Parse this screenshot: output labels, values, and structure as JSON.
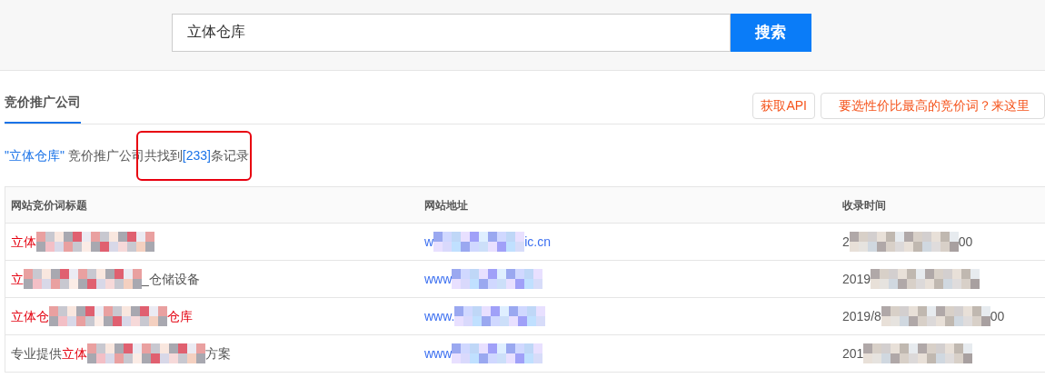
{
  "search": {
    "value": "立体仓库",
    "button": "搜索"
  },
  "tabs": [
    {
      "label": "竞价推广公司",
      "selected": true
    }
  ],
  "actions": [
    "获取API",
    "要选性价比最高的竞价词？来这里"
  ],
  "summary": {
    "query": "\"立体仓库\"",
    "text": " 竞价推广公司共找到",
    "count": "[233]",
    "suffix": "条记录",
    "annotated": true
  },
  "table": {
    "columns": [
      "网站竞价词标题",
      "网站地址",
      "收录时间"
    ],
    "rows": [
      {
        "cells": [
          [
            {
              "kind": "text",
              "text": "立体",
              "highlight": true
            },
            {
              "kind": "mosaic"
            }
          ],
          [
            {
              "kind": "text",
              "text": "w"
            },
            {
              "kind": "mosaic"
            },
            {
              "kind": "text",
              "text": "ic.cn"
            }
          ],
          [
            {
              "kind": "text",
              "text": "2"
            },
            {
              "kind": "mosaic"
            },
            {
              "kind": "text",
              "text": "00"
            }
          ]
        ]
      },
      {
        "cells": [
          [
            {
              "kind": "text",
              "text": "立",
              "highlight": true
            },
            {
              "kind": "mosaic"
            },
            {
              "kind": "text",
              "text": "_仓储设备"
            }
          ],
          [
            {
              "kind": "text",
              "text": "www"
            },
            {
              "kind": "mosaic"
            }
          ],
          [
            {
              "kind": "text",
              "text": "2019"
            },
            {
              "kind": "mosaic"
            }
          ]
        ]
      },
      {
        "cells": [
          [
            {
              "kind": "text",
              "text": "立体仓",
              "highlight": true
            },
            {
              "kind": "mosaic"
            },
            {
              "kind": "text",
              "text": "仓库",
              "highlight": true
            }
          ],
          [
            {
              "kind": "text",
              "text": "www."
            },
            {
              "kind": "mosaic"
            }
          ],
          [
            {
              "kind": "text",
              "text": "2019/8"
            },
            {
              "kind": "mosaic"
            },
            {
              "kind": "text",
              "text": "00"
            }
          ]
        ]
      },
      {
        "cells": [
          [
            {
              "kind": "text",
              "text": "专业提供"
            },
            {
              "kind": "text",
              "text": "立体",
              "highlight": true
            },
            {
              "kind": "mosaic"
            },
            {
              "kind": "text",
              "text": "方案"
            }
          ],
          [
            {
              "kind": "text",
              "text": "www"
            },
            {
              "kind": "mosaic"
            }
          ],
          [
            {
              "kind": "text",
              "text": "201"
            },
            {
              "kind": "mosaic"
            }
          ]
        ]
      }
    ]
  }
}
